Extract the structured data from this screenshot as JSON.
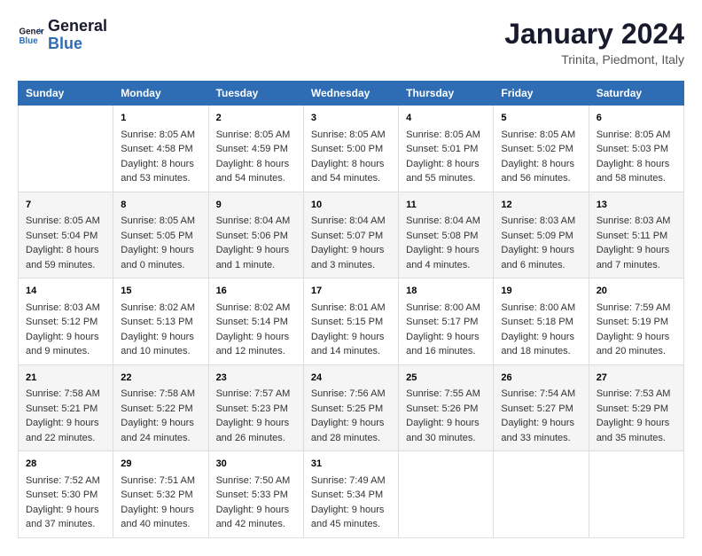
{
  "logo": {
    "text_general": "General",
    "text_blue": "Blue"
  },
  "title": "January 2024",
  "subtitle": "Trinita, Piedmont, Italy",
  "header_days": [
    "Sunday",
    "Monday",
    "Tuesday",
    "Wednesday",
    "Thursday",
    "Friday",
    "Saturday"
  ],
  "weeks": [
    [
      {
        "day": "",
        "info": ""
      },
      {
        "day": "1",
        "sunrise": "8:05 AM",
        "sunset": "4:58 PM",
        "daylight": "8 hours and 53 minutes."
      },
      {
        "day": "2",
        "sunrise": "8:05 AM",
        "sunset": "4:59 PM",
        "daylight": "8 hours and 54 minutes."
      },
      {
        "day": "3",
        "sunrise": "8:05 AM",
        "sunset": "5:00 PM",
        "daylight": "8 hours and 54 minutes."
      },
      {
        "day": "4",
        "sunrise": "8:05 AM",
        "sunset": "5:01 PM",
        "daylight": "8 hours and 55 minutes."
      },
      {
        "day": "5",
        "sunrise": "8:05 AM",
        "sunset": "5:02 PM",
        "daylight": "8 hours and 56 minutes."
      },
      {
        "day": "6",
        "sunrise": "8:05 AM",
        "sunset": "5:03 PM",
        "daylight": "8 hours and 58 minutes."
      }
    ],
    [
      {
        "day": "7",
        "sunrise": "8:05 AM",
        "sunset": "5:04 PM",
        "daylight": "8 hours and 59 minutes."
      },
      {
        "day": "8",
        "sunrise": "8:05 AM",
        "sunset": "5:05 PM",
        "daylight": "9 hours and 0 minutes."
      },
      {
        "day": "9",
        "sunrise": "8:04 AM",
        "sunset": "5:06 PM",
        "daylight": "9 hours and 1 minute."
      },
      {
        "day": "10",
        "sunrise": "8:04 AM",
        "sunset": "5:07 PM",
        "daylight": "9 hours and 3 minutes."
      },
      {
        "day": "11",
        "sunrise": "8:04 AM",
        "sunset": "5:08 PM",
        "daylight": "9 hours and 4 minutes."
      },
      {
        "day": "12",
        "sunrise": "8:03 AM",
        "sunset": "5:09 PM",
        "daylight": "9 hours and 6 minutes."
      },
      {
        "day": "13",
        "sunrise": "8:03 AM",
        "sunset": "5:11 PM",
        "daylight": "9 hours and 7 minutes."
      }
    ],
    [
      {
        "day": "14",
        "sunrise": "8:03 AM",
        "sunset": "5:12 PM",
        "daylight": "9 hours and 9 minutes."
      },
      {
        "day": "15",
        "sunrise": "8:02 AM",
        "sunset": "5:13 PM",
        "daylight": "9 hours and 10 minutes."
      },
      {
        "day": "16",
        "sunrise": "8:02 AM",
        "sunset": "5:14 PM",
        "daylight": "9 hours and 12 minutes."
      },
      {
        "day": "17",
        "sunrise": "8:01 AM",
        "sunset": "5:15 PM",
        "daylight": "9 hours and 14 minutes."
      },
      {
        "day": "18",
        "sunrise": "8:00 AM",
        "sunset": "5:17 PM",
        "daylight": "9 hours and 16 minutes."
      },
      {
        "day": "19",
        "sunrise": "8:00 AM",
        "sunset": "5:18 PM",
        "daylight": "9 hours and 18 minutes."
      },
      {
        "day": "20",
        "sunrise": "7:59 AM",
        "sunset": "5:19 PM",
        "daylight": "9 hours and 20 minutes."
      }
    ],
    [
      {
        "day": "21",
        "sunrise": "7:58 AM",
        "sunset": "5:21 PM",
        "daylight": "9 hours and 22 minutes."
      },
      {
        "day": "22",
        "sunrise": "7:58 AM",
        "sunset": "5:22 PM",
        "daylight": "9 hours and 24 minutes."
      },
      {
        "day": "23",
        "sunrise": "7:57 AM",
        "sunset": "5:23 PM",
        "daylight": "9 hours and 26 minutes."
      },
      {
        "day": "24",
        "sunrise": "7:56 AM",
        "sunset": "5:25 PM",
        "daylight": "9 hours and 28 minutes."
      },
      {
        "day": "25",
        "sunrise": "7:55 AM",
        "sunset": "5:26 PM",
        "daylight": "9 hours and 30 minutes."
      },
      {
        "day": "26",
        "sunrise": "7:54 AM",
        "sunset": "5:27 PM",
        "daylight": "9 hours and 33 minutes."
      },
      {
        "day": "27",
        "sunrise": "7:53 AM",
        "sunset": "5:29 PM",
        "daylight": "9 hours and 35 minutes."
      }
    ],
    [
      {
        "day": "28",
        "sunrise": "7:52 AM",
        "sunset": "5:30 PM",
        "daylight": "9 hours and 37 minutes."
      },
      {
        "day": "29",
        "sunrise": "7:51 AM",
        "sunset": "5:32 PM",
        "daylight": "9 hours and 40 minutes."
      },
      {
        "day": "30",
        "sunrise": "7:50 AM",
        "sunset": "5:33 PM",
        "daylight": "9 hours and 42 minutes."
      },
      {
        "day": "31",
        "sunrise": "7:49 AM",
        "sunset": "5:34 PM",
        "daylight": "9 hours and 45 minutes."
      },
      {
        "day": "",
        "info": ""
      },
      {
        "day": "",
        "info": ""
      },
      {
        "day": "",
        "info": ""
      }
    ]
  ],
  "labels": {
    "sunrise": "Sunrise: ",
    "sunset": "Sunset: ",
    "daylight": "Daylight: "
  }
}
